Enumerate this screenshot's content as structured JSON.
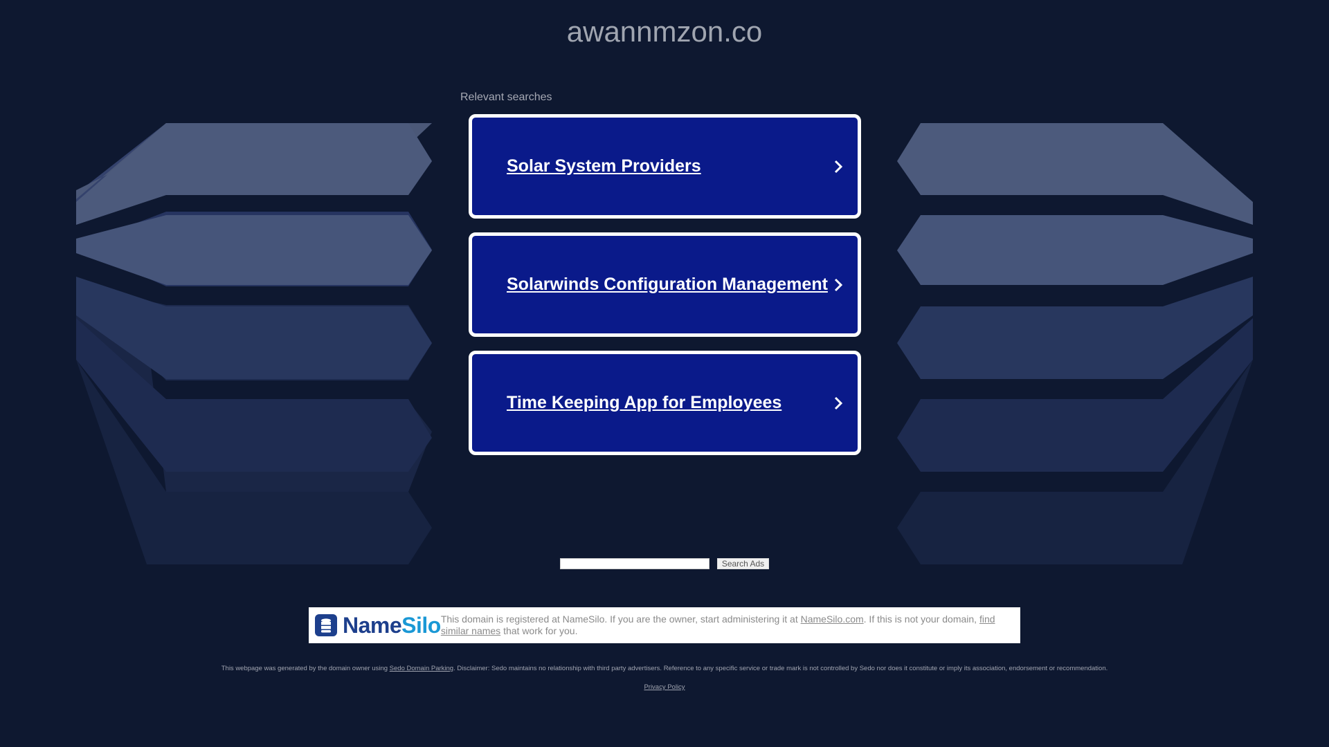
{
  "header": {
    "domain_title": "awannmzon.co"
  },
  "relevant": {
    "heading": "Relevant searches",
    "items": [
      {
        "label": "Solar System Providers"
      },
      {
        "label": "Solarwinds Configuration Management"
      },
      {
        "label": "Time Keeping App for Employees"
      }
    ]
  },
  "search": {
    "input_value": "",
    "button_label": "Search Ads"
  },
  "registrar": {
    "logo_name": "NameSilo",
    "logo_name_a": "Name",
    "logo_name_b": "Silo",
    "text_before": "This domain is registered at NameSilo. If you are the owner, start administering it at ",
    "link_namesilo": "NameSilo.com",
    "text_middle": ". If this is not your domain, ",
    "link_similar": "find similar names",
    "text_after": " that work for you."
  },
  "footer": {
    "disclaimer_before": "This webpage was generated by the domain owner using ",
    "disclaimer_link": "Sedo Domain Parking",
    "disclaimer_after": ". Disclaimer: Sedo maintains no relationship with third party advertisers. Reference to any specific service or trade mark is not controlled by Sedo nor does it constitute or imply its association, endorsement or recommendation.",
    "privacy_label": "Privacy Policy"
  },
  "colors": {
    "background": "#0e1830",
    "card_fill": "#0a1a8a",
    "card_border": "#ffffff",
    "namesilo_blue": "#1d3f8c",
    "namesilo_light": "#1a98d5"
  }
}
